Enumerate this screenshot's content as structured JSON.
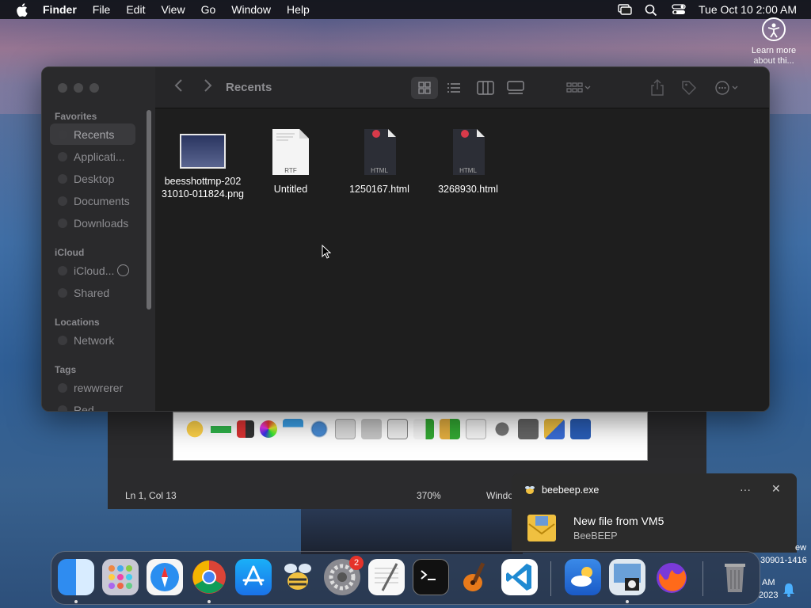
{
  "menubar": {
    "app": "Finder",
    "items": [
      "File",
      "Edit",
      "View",
      "Go",
      "Window",
      "Help"
    ],
    "clock": "Tue Oct 10  2:00 AM"
  },
  "widget": {
    "text": "Learn more about thi..."
  },
  "finder": {
    "title": "Recents",
    "sidebar": {
      "favorites_label": "Favorites",
      "favorites": [
        "Recents",
        "Applicati...",
        "Desktop",
        "Documents",
        "Downloads"
      ],
      "icloud_label": "iCloud",
      "icloud": [
        "iCloud...",
        "Shared"
      ],
      "locations_label": "Locations",
      "locations": [
        "Network"
      ],
      "tags_label": "Tags",
      "tags": [
        "rewwrerer",
        "Red"
      ]
    },
    "files": [
      {
        "name": "beesshottmp-20231010-011824.png",
        "line1": "beesshottmp-202",
        "line2": "31010-011824.png",
        "kind": "png"
      },
      {
        "name": "Untitled",
        "line1": "Untitled",
        "line2": "",
        "kind": "rtf",
        "badge": "RTF"
      },
      {
        "name": "1250167.html",
        "line1": "1250167.html",
        "line2": "",
        "kind": "html",
        "badge": "HTML"
      },
      {
        "name": "3268930.html",
        "line1": "3268930.html",
        "line2": "",
        "kind": "html",
        "badge": "HTML"
      }
    ]
  },
  "editor": {
    "status_position": "Ln 1, Col 13",
    "status_zoom": "370%",
    "status_window": "Windo"
  },
  "notification": {
    "app": "beebeep.exe",
    "more": "···",
    "close": "✕",
    "title": "New file from VM5",
    "subtitle": "BeeBEEP"
  },
  "tray": {
    "frag1": "ew",
    "frag2": "30901-1416",
    "frag3": "AM",
    "frag4": "2023"
  },
  "dock": {
    "items": [
      "Finder",
      "Launchpad",
      "Safari",
      "Chrome",
      "App Store",
      "BeeBEEP",
      "System Settings",
      "TextEdit",
      "Terminal",
      "GarageBand",
      "VS Code",
      "Weather",
      "Preview",
      "Firefox",
      "Trash"
    ],
    "settings_badge": "2"
  },
  "colors": {
    "accent": "#3a3a3d",
    "badge": "#e5332a"
  }
}
